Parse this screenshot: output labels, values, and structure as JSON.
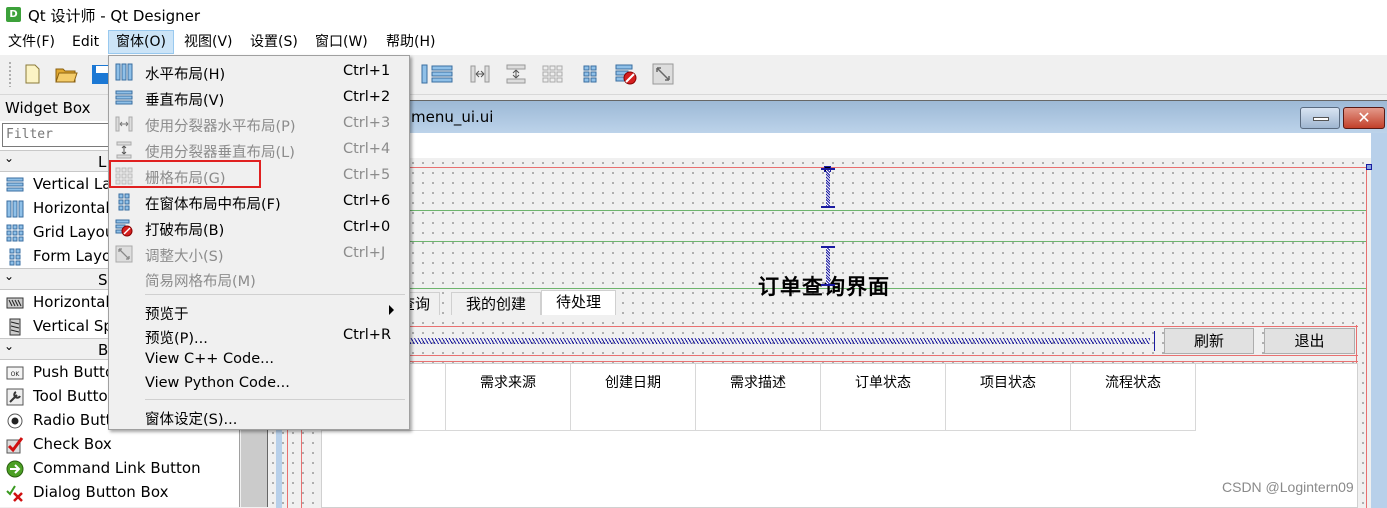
{
  "window": {
    "title": "Qt 设计师 - Qt Designer",
    "app_icon_letter": "D"
  },
  "menubar": [
    {
      "label": "文件(F)"
    },
    {
      "label": "Edit"
    },
    {
      "label": "窗体(O)",
      "active": true
    },
    {
      "label": "视图(V)"
    },
    {
      "label": "设置(S)"
    },
    {
      "label": "窗口(W)"
    },
    {
      "label": "帮助(H)"
    }
  ],
  "toolbar": {
    "icons": [
      "new-file-icon",
      "open-folder-icon",
      "save-icon",
      "layout-horizontal-icon",
      "layout-vertical-icon",
      "splitter-horizontal-icon",
      "splitter-vertical-icon",
      "grid-layout-icon",
      "form-layout-icon",
      "break-layout-icon",
      "adjust-size-icon"
    ]
  },
  "form_menu": {
    "items": [
      {
        "label": "水平布局(H)",
        "shortcut": "Ctrl+1",
        "icon": "layout-horizontal-icon",
        "enabled": true
      },
      {
        "label": "垂直布局(V)",
        "shortcut": "Ctrl+2",
        "icon": "layout-vertical-icon",
        "enabled": true
      },
      {
        "label": "使用分裂器水平布局(P)",
        "shortcut": "Ctrl+3",
        "icon": "splitter-horizontal-icon",
        "enabled": false
      },
      {
        "label": "使用分裂器垂直布局(L)",
        "shortcut": "Ctrl+4",
        "icon": "splitter-vertical-icon",
        "enabled": false
      },
      {
        "label": "栅格布局(G)",
        "shortcut": "Ctrl+5",
        "icon": "grid-layout-icon",
        "enabled": false,
        "highlighted": true
      },
      {
        "label": "在窗体布局中布局(F)",
        "shortcut": "Ctrl+6",
        "icon": "form-layout-icon",
        "enabled": true
      },
      {
        "label": "打破布局(B)",
        "shortcut": "Ctrl+0",
        "icon": "break-layout-icon",
        "enabled": true
      },
      {
        "label": "调整大小(S)",
        "shortcut": "Ctrl+J",
        "icon": "adjust-size-icon",
        "enabled": false
      },
      {
        "label": "简易网格布局(M)",
        "shortcut": "",
        "enabled": false
      },
      {
        "label": "预览于",
        "submenu": true,
        "enabled": true
      },
      {
        "label": "预览(P)...",
        "shortcut": "Ctrl+R",
        "enabled": true
      },
      {
        "label": "View C++ Code...",
        "enabled": true
      },
      {
        "label": "View Python Code...",
        "enabled": true
      },
      {
        "label": "窗体设定(S)...",
        "enabled": true
      }
    ]
  },
  "widget_box": {
    "title": "Widget Box",
    "filter_placeholder": "Filter",
    "categories": [
      {
        "label": "L",
        "items": [
          "Vertical La",
          "Horizontal",
          "Grid Layou",
          "Form Layo"
        ]
      },
      {
        "label": "S",
        "items": [
          "Horizontal",
          "Vertical Sp"
        ]
      },
      {
        "label": "B",
        "items": [
          "Push Butto",
          "Tool Butto",
          "Radio Butt",
          "Check Box",
          "Command Link Button",
          "Dialog Button Box"
        ]
      }
    ]
  },
  "form": {
    "file_title": "menu_ui.ui",
    "heading": "订单查询界面",
    "tabs": [
      "查询",
      "我的创建",
      "待处理"
    ],
    "active_tab": "待处理",
    "buttons": {
      "refresh": "刷新",
      "exit": "退出"
    },
    "table_headers": [
      "",
      "需求来源",
      "创建日期",
      "需求描述",
      "订单状态",
      "项目状态",
      "流程状态"
    ]
  },
  "watermark": "CSDN @Logintern09",
  "colors": {
    "accent_menu": "#cce4f7",
    "layout_red": "#e87070",
    "layout_green": "#6cb46c",
    "spacer_blue": "#1a1aa0",
    "highlight_red": "#e02020"
  }
}
